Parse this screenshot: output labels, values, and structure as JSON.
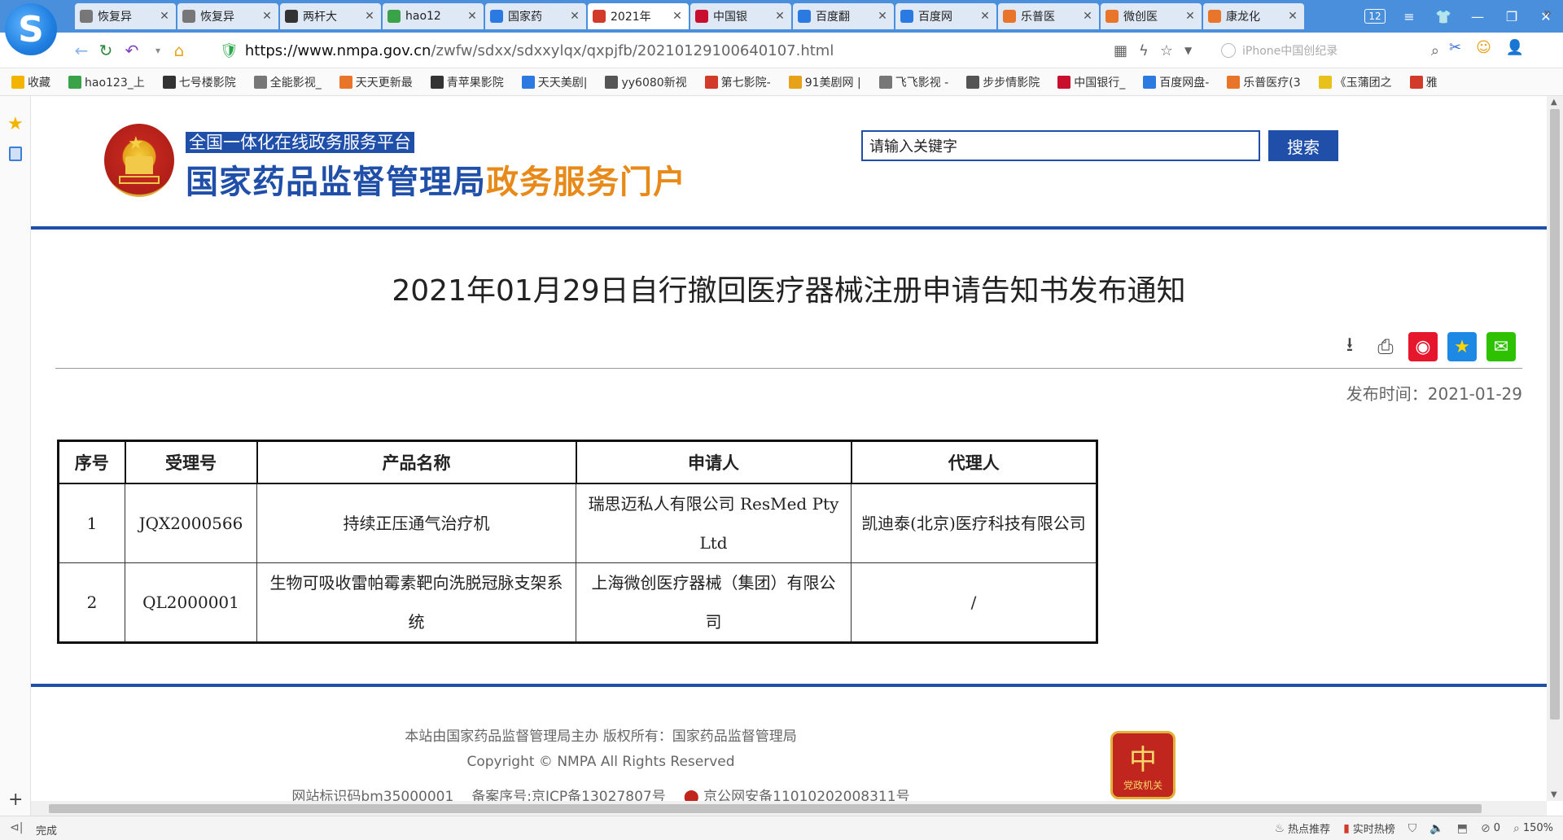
{
  "browser": {
    "tabs": [
      {
        "label": "恢复异",
        "color": "#777777",
        "active": false
      },
      {
        "label": "恢复异",
        "color": "#777777",
        "active": false
      },
      {
        "label": "两杆大",
        "color": "#333333",
        "active": false
      },
      {
        "label": "hao12",
        "color": "#3aa34a",
        "active": false
      },
      {
        "label": "国家药",
        "color": "#2a7ae2",
        "active": false
      },
      {
        "label": "2021年",
        "color": "#d23a2a",
        "active": true
      },
      {
        "label": "中国银",
        "color": "#c8102e",
        "active": false
      },
      {
        "label": "百度翻",
        "color": "#2a7ae2",
        "active": false
      },
      {
        "label": "百度网",
        "color": "#2a7ae2",
        "active": false
      },
      {
        "label": "乐普医",
        "color": "#e8752a",
        "active": false
      },
      {
        "label": "微创医",
        "color": "#e8752a",
        "active": false
      },
      {
        "label": "康龙化",
        "color": "#e8752a",
        "active": false
      }
    ],
    "tab_count": "12",
    "url_scheme_host": "https://www.nmpa.gov.cn",
    "url_path": "/zwfw/sdxx/sdxxylqx/qxpjfb/20210129100640107.html",
    "search_placeholder": "iPhone中国创纪录",
    "bookmarks": [
      {
        "label": "收藏",
        "color": "#f3b400"
      },
      {
        "label": "hao123_上",
        "color": "#3aa34a"
      },
      {
        "label": "七号楼影院",
        "color": "#333333"
      },
      {
        "label": "全能影视_",
        "color": "#777777"
      },
      {
        "label": "天天更新最",
        "color": "#e8752a"
      },
      {
        "label": "青苹果影院",
        "color": "#333333"
      },
      {
        "label": "天天美剧|",
        "color": "#2a7ae2"
      },
      {
        "label": "yy6080新视",
        "color": "#555555"
      },
      {
        "label": "第七影院-",
        "color": "#d23a2a"
      },
      {
        "label": "91美剧网 |",
        "color": "#e8a21a"
      },
      {
        "label": "飞飞影视 -",
        "color": "#777777"
      },
      {
        "label": "步步情影院",
        "color": "#555555"
      },
      {
        "label": "中国银行_",
        "color": "#c8102e"
      },
      {
        "label": "百度网盘-",
        "color": "#2a7ae2"
      },
      {
        "label": "乐普医疗(3",
        "color": "#e8752a"
      },
      {
        "label": "《玉蒲团之",
        "color": "#e8c21a"
      },
      {
        "label": "雅",
        "color": "#d23a2a"
      }
    ],
    "status_text": "完成",
    "status_items": [
      "热点推荐",
      "实时热榜",
      "0",
      "150%"
    ]
  },
  "site": {
    "platform_label": "全国一体化在线政务服务平台",
    "title_main": "国家药品监督管理局",
    "title_accent": "政务服务门户",
    "search_placeholder": "请输入关键字",
    "search_button": "搜索"
  },
  "article": {
    "title": "2021年01月29日自行撤回医疗器械注册申请告知书发布通知",
    "publish_date": "发布时间：2021-01-29",
    "table": {
      "headers": [
        "序号",
        "受理号",
        "产品名称",
        "申请人",
        "代理人"
      ],
      "rows": [
        [
          "1",
          "JQX2000566",
          "持续正压通气治疗机",
          "瑞思迈私人有限公司 ResMed Pty Ltd",
          "凯迪泰(北京)医疗科技有限公司"
        ],
        [
          "2",
          "QL2000001",
          "生物可吸收雷帕霉素靶向洗脱冠脉支架系统",
          "上海微创医疗器械（集团）有限公司",
          "/"
        ]
      ]
    }
  },
  "footer": {
    "line1": "本站由国家药品监督管理局主办 版权所有：国家药品监督管理局",
    "line2": "Copyright © NMPA All Rights Reserved",
    "site_code": "网站标识码bm35000001",
    "icp": "备案序号:京ICP备13027807号",
    "police": "京公网安备11010202008311号",
    "badge_text": "党政机关"
  }
}
